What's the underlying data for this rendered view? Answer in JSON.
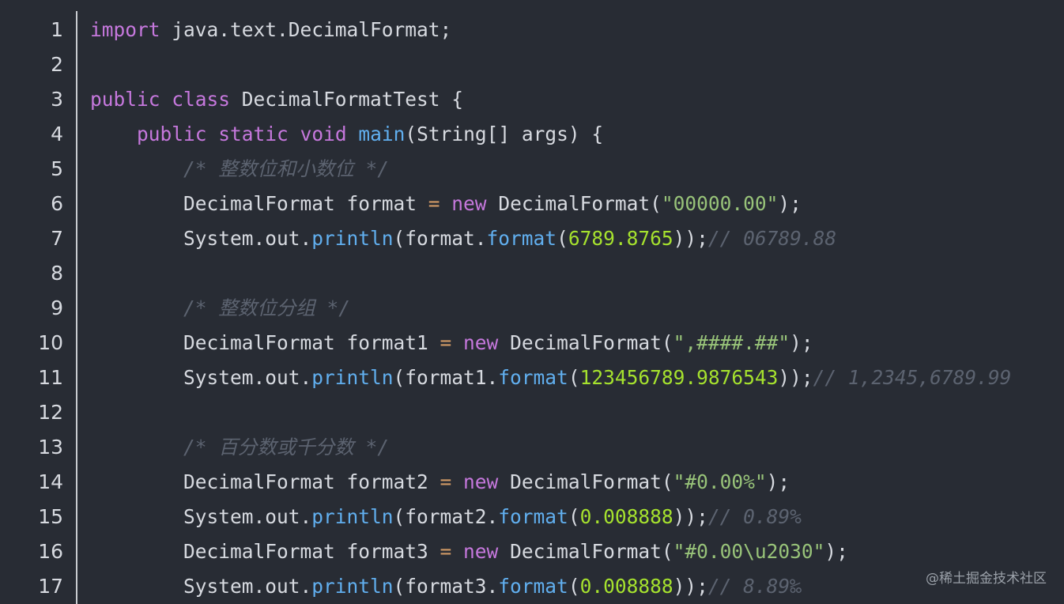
{
  "editor": {
    "lines": [
      {
        "n": "1",
        "t": [
          [
            "kw",
            "import"
          ],
          [
            "pl",
            " java.text.DecimalFormat;"
          ]
        ]
      },
      {
        "n": "2",
        "t": []
      },
      {
        "n": "3",
        "t": [
          [
            "kw",
            "public"
          ],
          [
            "pl",
            " "
          ],
          [
            "kw",
            "class"
          ],
          [
            "pl",
            " DecimalFormatTest {"
          ]
        ]
      },
      {
        "n": "4",
        "t": [
          [
            "pl",
            "    "
          ],
          [
            "kw",
            "public"
          ],
          [
            "pl",
            " "
          ],
          [
            "kw",
            "static"
          ],
          [
            "pl",
            " "
          ],
          [
            "kw",
            "void"
          ],
          [
            "pl",
            " "
          ],
          [
            "fn",
            "main"
          ],
          [
            "pl",
            "(String[] args) {"
          ]
        ]
      },
      {
        "n": "5",
        "t": [
          [
            "pl",
            "        "
          ],
          [
            "cm",
            "/* 整数位和小数位 */"
          ]
        ]
      },
      {
        "n": "6",
        "t": [
          [
            "pl",
            "        DecimalFormat format "
          ],
          [
            "op",
            "="
          ],
          [
            "pl",
            " "
          ],
          [
            "kw",
            "new"
          ],
          [
            "pl",
            " DecimalFormat("
          ],
          [
            "str",
            "\"00000.00\""
          ],
          [
            "pl",
            ");"
          ]
        ]
      },
      {
        "n": "7",
        "t": [
          [
            "pl",
            "        System.out."
          ],
          [
            "fn",
            "println"
          ],
          [
            "pl",
            "(format."
          ],
          [
            "fn",
            "format"
          ],
          [
            "pl",
            "("
          ],
          [
            "num",
            "6789.8765"
          ],
          [
            "pl",
            "));"
          ],
          [
            "cm",
            "// 06789.88"
          ]
        ]
      },
      {
        "n": "8",
        "t": []
      },
      {
        "n": "9",
        "t": [
          [
            "pl",
            "        "
          ],
          [
            "cm",
            "/* 整数位分组 */"
          ]
        ]
      },
      {
        "n": "10",
        "t": [
          [
            "pl",
            "        DecimalFormat format1 "
          ],
          [
            "op",
            "="
          ],
          [
            "pl",
            " "
          ],
          [
            "kw",
            "new"
          ],
          [
            "pl",
            " DecimalFormat("
          ],
          [
            "str",
            "\",####.##\""
          ],
          [
            "pl",
            ");"
          ]
        ]
      },
      {
        "n": "11",
        "t": [
          [
            "pl",
            "        System.out."
          ],
          [
            "fn",
            "println"
          ],
          [
            "pl",
            "(format1."
          ],
          [
            "fn",
            "format"
          ],
          [
            "pl",
            "("
          ],
          [
            "num",
            "123456789.9876543"
          ],
          [
            "pl",
            "));"
          ],
          [
            "cm",
            "// 1,2345,6789.99"
          ]
        ]
      },
      {
        "n": "12",
        "t": []
      },
      {
        "n": "13",
        "t": [
          [
            "pl",
            "        "
          ],
          [
            "cm",
            "/* 百分数或千分数 */"
          ]
        ]
      },
      {
        "n": "14",
        "t": [
          [
            "pl",
            "        DecimalFormat format2 "
          ],
          [
            "op",
            "="
          ],
          [
            "pl",
            " "
          ],
          [
            "kw",
            "new"
          ],
          [
            "pl",
            " DecimalFormat("
          ],
          [
            "str",
            "\"#0.00%\""
          ],
          [
            "pl",
            ");"
          ]
        ]
      },
      {
        "n": "15",
        "t": [
          [
            "pl",
            "        System.out."
          ],
          [
            "fn",
            "println"
          ],
          [
            "pl",
            "(format2."
          ],
          [
            "fn",
            "format"
          ],
          [
            "pl",
            "("
          ],
          [
            "num",
            "0.008888"
          ],
          [
            "pl",
            "));"
          ],
          [
            "cm",
            "// 0.89%"
          ]
        ]
      },
      {
        "n": "16",
        "t": [
          [
            "pl",
            "        DecimalFormat format3 "
          ],
          [
            "op",
            "="
          ],
          [
            "pl",
            " "
          ],
          [
            "kw",
            "new"
          ],
          [
            "pl",
            " DecimalFormat("
          ],
          [
            "str",
            "\"#0.00\\u2030\""
          ],
          [
            "pl",
            ");"
          ]
        ]
      },
      {
        "n": "17",
        "t": [
          [
            "pl",
            "        System.out."
          ],
          [
            "fn",
            "println"
          ],
          [
            "pl",
            "(format3."
          ],
          [
            "fn",
            "format"
          ],
          [
            "pl",
            "("
          ],
          [
            "num",
            "0.008888"
          ],
          [
            "pl",
            "));"
          ],
          [
            "cm",
            "// 8.89‰"
          ]
        ]
      }
    ]
  },
  "watermark": "@稀土掘金技术社区"
}
